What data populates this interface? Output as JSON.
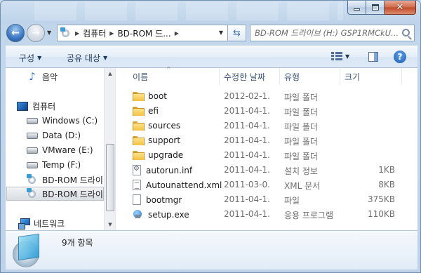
{
  "window": {
    "caption": {
      "minimize": "minimize",
      "maximize": "maximize",
      "close": "✕"
    }
  },
  "address_bar": {
    "crumbs": [
      "컴퓨터",
      "BD-ROM 드..."
    ],
    "search_placeholder": "BD-ROM 드라이브 (H:) GSP1RMCkU..."
  },
  "toolbar": {
    "organize": "구성",
    "share": "공유 대상",
    "help": "?"
  },
  "nav": {
    "items": [
      {
        "label": "음악",
        "icon": "music-icon"
      },
      {
        "label": "컴퓨터",
        "icon": "computer-icon"
      },
      {
        "label": "Windows (C:)",
        "icon": "windows-drive-icon"
      },
      {
        "label": "Data (D:)",
        "icon": "drive-icon"
      },
      {
        "label": "VMware (E:)",
        "icon": "drive-icon"
      },
      {
        "label": "Temp (F:)",
        "icon": "drive-icon"
      },
      {
        "label": "BD-ROM 드라이",
        "icon": "cd-drive-icon"
      },
      {
        "label": "BD-ROM 드라이",
        "icon": "cd-drive-icon",
        "selected": true
      },
      {
        "label": "네트워크",
        "icon": "network-icon"
      }
    ]
  },
  "files": {
    "columns": {
      "name": "이름",
      "date": "수정한 날짜",
      "type": "유형",
      "size": "크기"
    },
    "rows": [
      {
        "name": "boot",
        "date": "2012-02-1...",
        "type": "파일 폴더",
        "size": "",
        "icon": "folder-icon"
      },
      {
        "name": "efi",
        "date": "2011-04-1...",
        "type": "파일 폴더",
        "size": "",
        "icon": "folder-icon"
      },
      {
        "name": "sources",
        "date": "2011-04-1...",
        "type": "파일 폴더",
        "size": "",
        "icon": "folder-icon"
      },
      {
        "name": "support",
        "date": "2011-04-1...",
        "type": "파일 폴더",
        "size": "",
        "icon": "folder-icon"
      },
      {
        "name": "upgrade",
        "date": "2011-04-1...",
        "type": "파일 폴더",
        "size": "",
        "icon": "folder-icon"
      },
      {
        "name": "autorun.inf",
        "date": "2011-04-1...",
        "type": "설치 정보",
        "size": "1KB",
        "icon": "settings-file-icon"
      },
      {
        "name": "Autounattend.xml",
        "date": "2011-03-0...",
        "type": "XML 문서",
        "size": "8KB",
        "icon": "document-icon"
      },
      {
        "name": "bootmgr",
        "date": "2011-04-1...",
        "type": "파일",
        "size": "375KB",
        "icon": "file-icon"
      },
      {
        "name": "setup.exe",
        "date": "2011-04-1...",
        "type": "응용 프로그램",
        "size": "110KB",
        "icon": "setup-icon"
      }
    ]
  },
  "details": {
    "count": "9개 항목"
  }
}
